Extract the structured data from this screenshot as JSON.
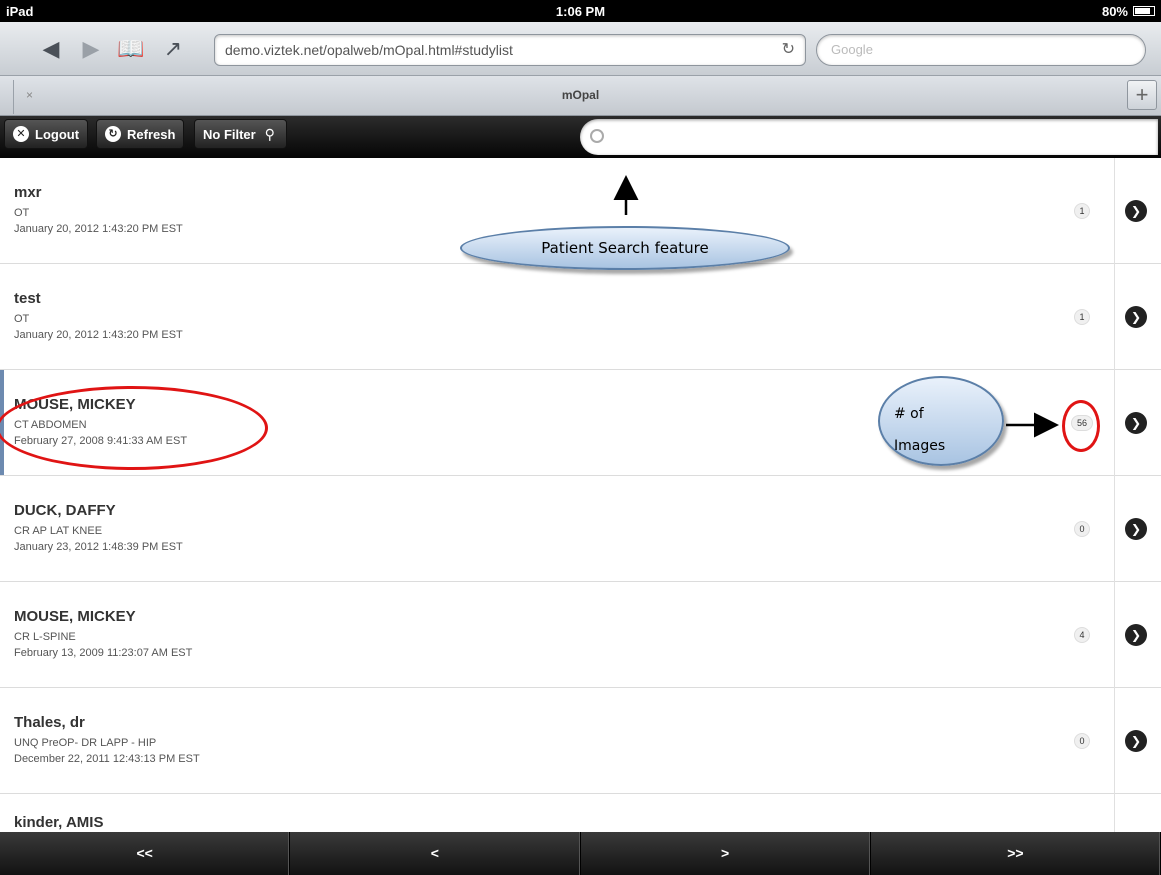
{
  "status_bar": {
    "device": "iPad",
    "time": "1:06 PM",
    "battery": "80%",
    "battery_level": 0.8
  },
  "browser": {
    "url": "demo.viztek.net/opalweb/mOpal.html#studylist",
    "search_placeholder": "Google",
    "tab_title": "mOpal",
    "tab_close": "×",
    "tab_add": "+"
  },
  "app_bar": {
    "logout_label": "Logout",
    "refresh_label": "Refresh",
    "filter_label": "No Filter",
    "search_placeholder": ""
  },
  "studies": [
    {
      "name": "mxr",
      "study": "OT",
      "date": "January 20, 2012 1:43:20 PM EST",
      "images": "1"
    },
    {
      "name": "test",
      "study": "OT",
      "date": "January 20, 2012 1:43:20 PM EST",
      "images": "1"
    },
    {
      "name": "MOUSE, MICKEY",
      "study": "CT ABDOMEN",
      "date": "February 27, 2008 9:41:33 AM EST",
      "images": "56"
    },
    {
      "name": "DUCK, DAFFY",
      "study": "CR AP LAT KNEE",
      "date": "January 23, 2012 1:48:39 PM EST",
      "images": "0"
    },
    {
      "name": "MOUSE, MICKEY",
      "study": "CR L-SPINE",
      "date": "February 13, 2009 11:23:07 AM EST",
      "images": "4"
    },
    {
      "name": "Thales, dr",
      "study": "UNQ PreOP- DR LAPP - HIP",
      "date": "December 22, 2011 12:43:13 PM EST",
      "images": "0"
    },
    {
      "name": "kinder, AMIS"
    }
  ],
  "pager": {
    "first": "<<",
    "prev": "<",
    "next": ">",
    "last": ">>"
  },
  "annotations": {
    "search_callout": "Patient Search feature",
    "images_callout_line1": "# of",
    "images_callout_line2": "Images",
    "color_highlight": "#e01414"
  }
}
